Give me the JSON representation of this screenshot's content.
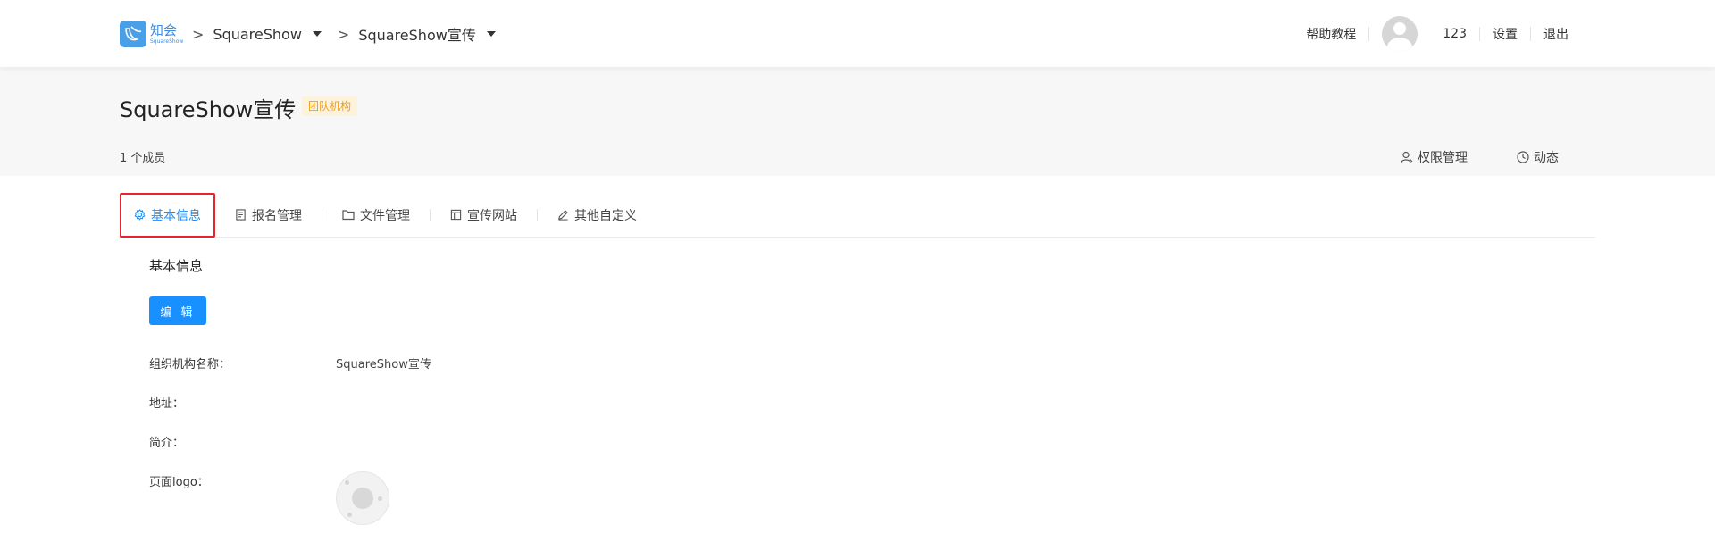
{
  "brand": {
    "name_cn": "知会",
    "name_en": "SquareShow"
  },
  "breadcrumb": [
    {
      "label": "SquareShow"
    },
    {
      "label": "SquareShow宣传"
    }
  ],
  "top_nav": {
    "help": "帮助教程",
    "username": "123",
    "settings": "设置",
    "logout": "退出"
  },
  "org": {
    "title": "SquareShow宣传",
    "tag": "团队机构",
    "members": "1 个成员"
  },
  "header_actions": {
    "permissions": "权限管理",
    "activity": "动态"
  },
  "tabs": [
    {
      "label": "基本信息",
      "icon": "gear-icon",
      "active": true
    },
    {
      "label": "报名管理",
      "icon": "form-icon",
      "active": false
    },
    {
      "label": "文件管理",
      "icon": "folder-icon",
      "active": false
    },
    {
      "label": "宣传网站",
      "icon": "layout-icon",
      "active": false
    },
    {
      "label": "其他自定义",
      "icon": "pencil-icon",
      "active": false
    }
  ],
  "content": {
    "section_title": "基本信息",
    "edit_button": "编 辑",
    "fields": [
      {
        "label": "组织机构名称：",
        "value": "SquareShow宣传"
      },
      {
        "label": "地址：",
        "value": ""
      },
      {
        "label": "简介：",
        "value": ""
      },
      {
        "label": "页面logo：",
        "value": ""
      }
    ]
  },
  "colors": {
    "accent": "#1890ff",
    "highlight_border": "#e8232b",
    "tag_text": "#f0a020",
    "tag_bg": "#fdf3dc"
  }
}
